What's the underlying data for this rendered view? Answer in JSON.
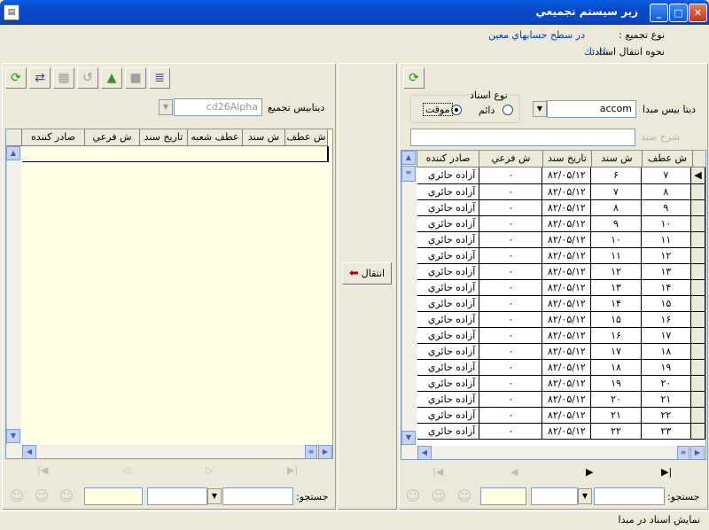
{
  "window": {
    "title": "زير سيستم تجميعي"
  },
  "header": {
    "merge_type_label": "نوع تجميع :",
    "merge_type_value": "در سطح حسابهاي معين",
    "transfer_label": "نحوه انتقال اسناد:",
    "transfer_value": "تك تك"
  },
  "source": {
    "db_label": "ديتا بيس مبدا",
    "db_value": "accom",
    "doc_type_label": "نوع اسناد",
    "opt_permanent": "دائم",
    "opt_temporary": "موقت",
    "description_placeholder": "شرح سند",
    "columns": [
      "ش عطف",
      "ش سند",
      "تاريخ سند",
      "ش فرعي",
      "صادر كننده"
    ],
    "rows": [
      [
        "۷",
        "۶",
        "۸۲/۰۵/۱۲",
        "۰",
        "آزاده حائري"
      ],
      [
        "۸",
        "۷",
        "۸۲/۰۵/۱۲",
        "۰",
        "آزاده حائري"
      ],
      [
        "۹",
        "۸",
        "۸۲/۰۵/۱۲",
        "۰",
        "آزاده حائري"
      ],
      [
        "۱۰",
        "۹",
        "۸۲/۰۵/۱۲",
        "۰",
        "آزاده حائري"
      ],
      [
        "۱۱",
        "۱۰",
        "۸۲/۰۵/۱۲",
        "۰",
        "آزاده حائري"
      ],
      [
        "۱۲",
        "۱۱",
        "۸۲/۰۵/۱۲",
        "۰",
        "آزاده حائري"
      ],
      [
        "۱۳",
        "۱۲",
        "۸۲/۰۵/۱۲",
        "۰",
        "آزاده حائري"
      ],
      [
        "۱۴",
        "۱۳",
        "۸۲/۰۵/۱۲",
        "۰",
        "آزاده حائري"
      ],
      [
        "۱۵",
        "۱۴",
        "۸۲/۰۵/۱۲",
        "۰",
        "آزاده حائري"
      ],
      [
        "۱۶",
        "۱۵",
        "۸۲/۰۵/۱۲",
        "۰",
        "آزاده حائري"
      ],
      [
        "۱۷",
        "۱۶",
        "۸۲/۰۵/۱۲",
        "۰",
        "آزاده حائري"
      ],
      [
        "۱۸",
        "۱۷",
        "۸۲/۰۵/۱۲",
        "۰",
        "آزاده حائري"
      ],
      [
        "۱۹",
        "۱۸",
        "۸۲/۰۵/۱۲",
        "۰",
        "آزاده حائري"
      ],
      [
        "۲۰",
        "۱۹",
        "۸۲/۰۵/۱۲",
        "۰",
        "آزاده حائري"
      ],
      [
        "۲۱",
        "۲۰",
        "۸۲/۰۵/۱۲",
        "۰",
        "آزاده حائري"
      ],
      [
        "۲۲",
        "۲۱",
        "۸۲/۰۵/۱۲",
        "۰",
        "آزاده حائري"
      ],
      [
        "۲۳",
        "۲۲",
        "۸۲/۰۵/۱۲",
        "۰",
        "آزاده حائري"
      ]
    ],
    "search_label": "جستجو:"
  },
  "target": {
    "db_label": "ديتابيس تجميع",
    "db_value": "cd26Alpha",
    "columns": [
      "ش عطف",
      "ش سند",
      "عطف شعبه",
      "تاريخ سند",
      "ش فرعي",
      "صادر كننده"
    ],
    "search_label": "جستجو:"
  },
  "transfer_button": "انتقال",
  "status": {
    "text": "نمايش اسناد در مبدا"
  }
}
